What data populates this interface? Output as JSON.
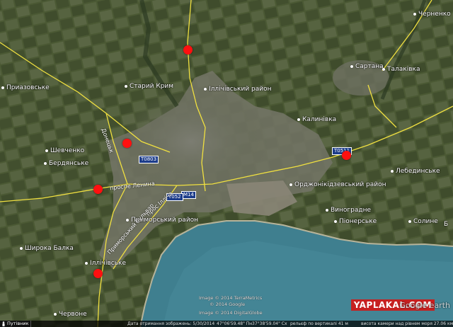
{
  "map": {
    "places": {
      "pryazovske": "Приазовське",
      "staryi_krym": "Старий Крим",
      "illichivskyi_raion": "Іллічівський район",
      "chernenko": "Черненко",
      "sartana": "Сартана",
      "talakivka": "Талаківка",
      "kalynivka": "Калинівка",
      "shevchenko": "Шевченко",
      "berdianske": "Бердянське",
      "lebedynske": "Лебединське",
      "ordzhonikidzevskyi_raion": "Орджонікідзевський район",
      "vynohradne": "Виноградне",
      "pionerske": "Піонерське",
      "solyne": "Солине",
      "primorskyi_raion": "Приморський район",
      "shyroka_balka": "Широка Балка",
      "illichivske": "Іллічівське",
      "chervone": "Червоне",
      "edge_b": "Б"
    },
    "roads": {
      "shield_t0803": "T0803",
      "shield_t0511": "T0511",
      "shield_m14": "M14",
      "shield_t052": "T052",
      "label_1": "проспе Ленина",
      "label_2": "Донецьк",
      "label_3": "Приморський бульвар",
      "label_4": "прос Ілліча"
    },
    "credits": {
      "line1": "Image © 2014 TerraMetrics",
      "line2": "© 2014 Google",
      "line3": "Image © 2014 DigitalGlobe"
    },
    "status": {
      "nav": "Путівник",
      "date": "Дата отримання зображень: 5/30/2014",
      "lat": "47°06'59.48\" Пн",
      "lon": "37°38'59.04\" Сх",
      "elev": "рельєф по вертикалі 41 м",
      "eye": "висота камери над рівнем моря 27.06 км"
    },
    "watermark": "YAPLAKAL.COM",
    "ge_logo": "Google earth",
    "colors": {
      "marker": "#ff1010",
      "road": "#f0e040",
      "sea": "#3f7f8f",
      "land": "#4f5c39"
    }
  }
}
